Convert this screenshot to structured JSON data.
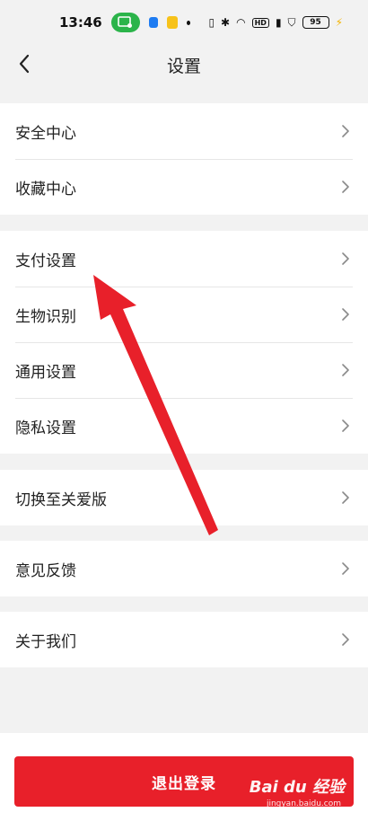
{
  "status_bar": {
    "time": "13:46",
    "battery": "95"
  },
  "nav": {
    "title": "设置"
  },
  "groups": [
    {
      "items": [
        {
          "label": "安全中心"
        },
        {
          "label": "收藏中心"
        }
      ]
    },
    {
      "items": [
        {
          "label": "支付设置"
        },
        {
          "label": "生物识别"
        },
        {
          "label": "通用设置"
        },
        {
          "label": "隐私设置"
        }
      ]
    },
    {
      "items": [
        {
          "label": "切换至关爱版"
        }
      ]
    },
    {
      "items": [
        {
          "label": "意见反馈"
        }
      ]
    },
    {
      "items": [
        {
          "label": "关于我们"
        }
      ]
    }
  ],
  "logout": {
    "label": "退出登录"
  },
  "watermark": {
    "brand": "Bai du 经验",
    "url": "jingyan.baidu.com"
  },
  "colors": {
    "accent": "#e8202a",
    "annotation_arrow": "#e8202a"
  }
}
